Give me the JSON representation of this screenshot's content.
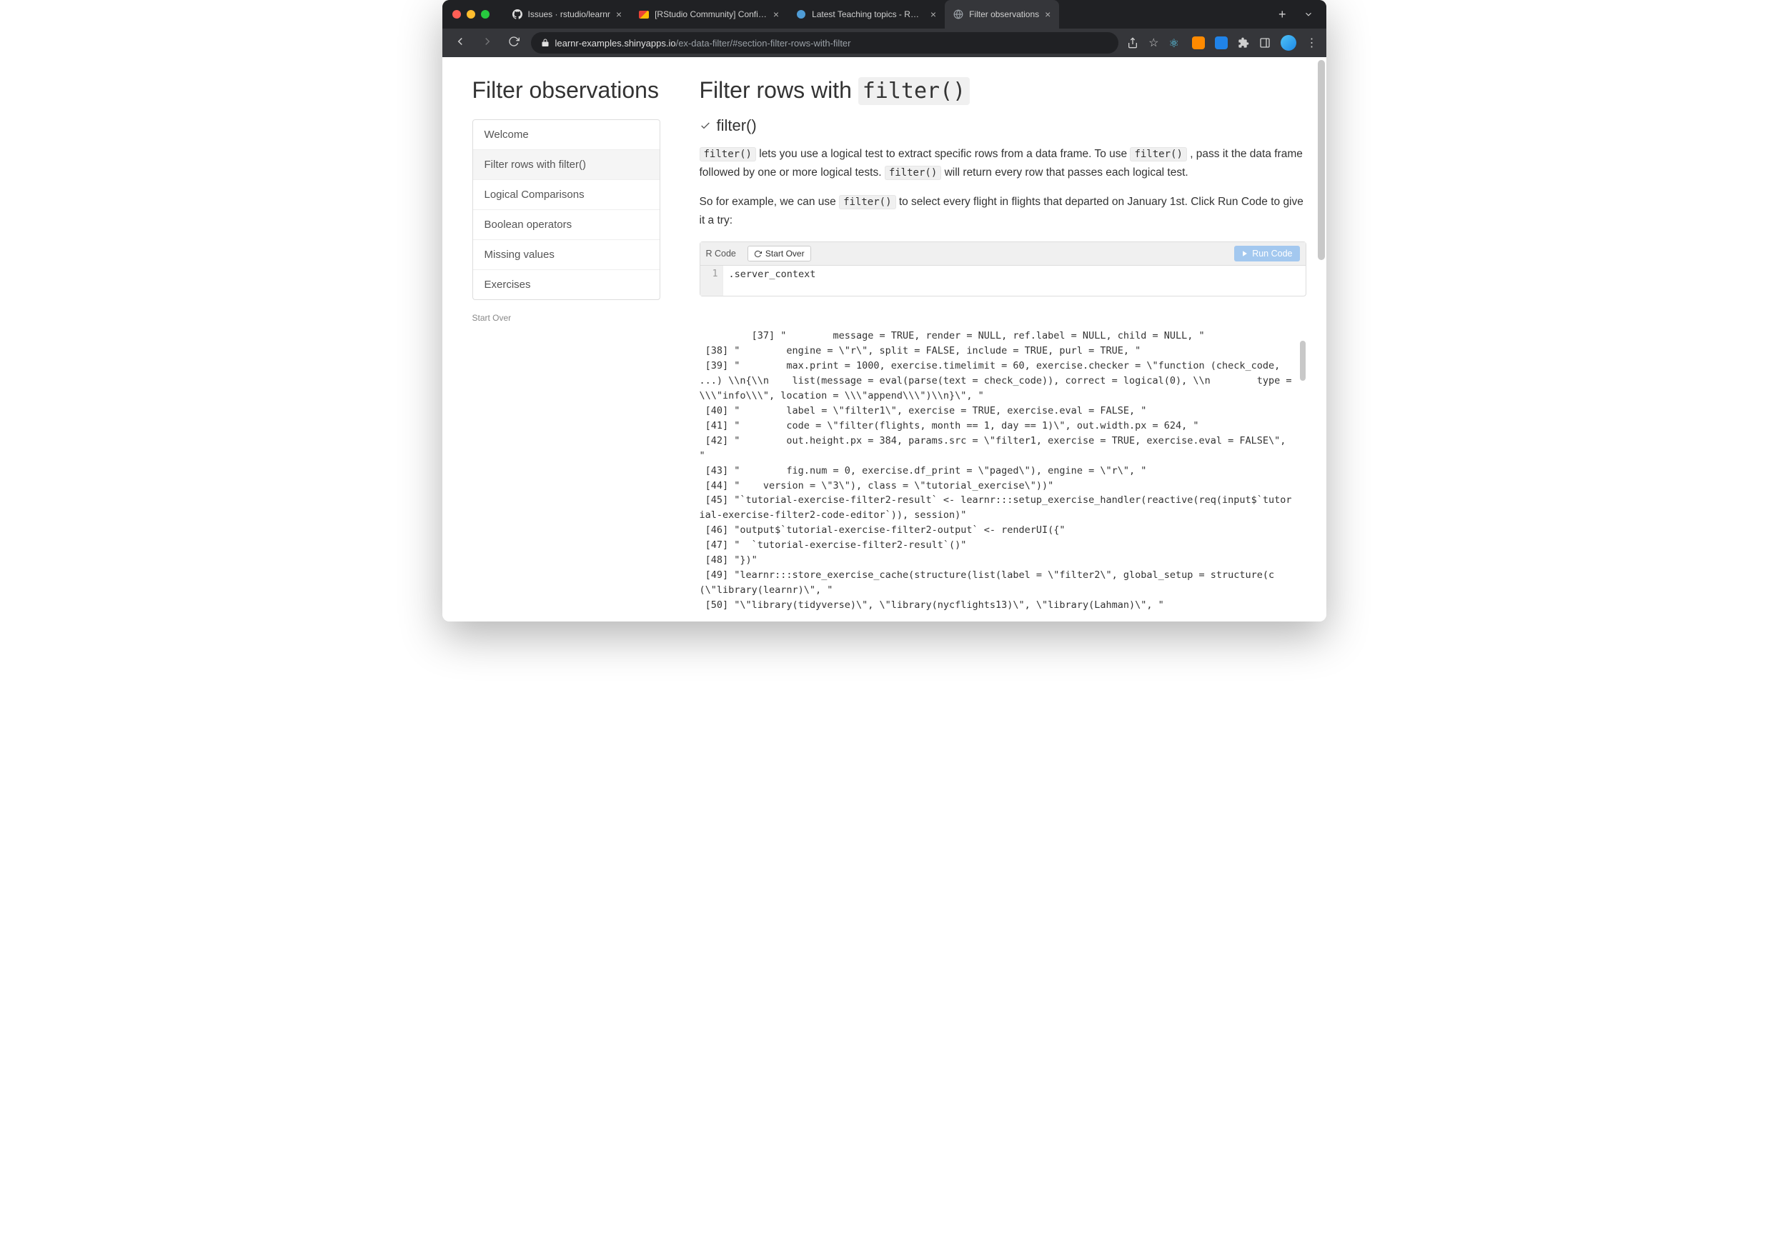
{
  "browser": {
    "tabs": [
      {
        "title": "Issues · rstudio/learnr",
        "active": false,
        "favicon": "github"
      },
      {
        "title": "[RStudio Community] Confirm",
        "active": false,
        "favicon": "gmail"
      },
      {
        "title": "Latest Teaching topics - RSt…",
        "active": false,
        "favicon": "rstudio"
      },
      {
        "title": "Filter observations",
        "active": true,
        "favicon": "globe"
      }
    ],
    "url_host": "learnr-examples.shinyapps.io",
    "url_path": "/ex-data-filter/#section-filter-rows-with-filter"
  },
  "sidebar": {
    "title": "Filter observations",
    "items": [
      {
        "label": "Welcome",
        "active": false
      },
      {
        "label": "Filter rows with filter()",
        "active": true
      },
      {
        "label": "Logical Comparisons",
        "active": false
      },
      {
        "label": "Boolean operators",
        "active": false
      },
      {
        "label": "Missing values",
        "active": false
      },
      {
        "label": "Exercises",
        "active": false
      }
    ],
    "start_over": "Start Over"
  },
  "main": {
    "heading_prefix": "Filter rows with ",
    "heading_code": "filter()",
    "subheading": "filter()",
    "para1_a": "filter()",
    "para1_b": " lets you use a logical test to extract specific rows from a data frame. To use ",
    "para1_c": "filter()",
    "para1_d": " , pass it the data frame followed by one or more logical tests. ",
    "para1_e": "filter()",
    "para1_f": " will return every row that passes each logical test.",
    "para2_a": "So for example, we can use ",
    "para2_b": "filter()",
    "para2_c": " to select every flight in flights that departed on January 1st. Click Run Code to give it a try:"
  },
  "exercise": {
    "label": "R Code",
    "start_over_label": "Start Over",
    "run_label": "Run Code",
    "gutter_line": "1",
    "code": ".server_context"
  },
  "output_lines": [
    " [37] \"        message = TRUE, render = NULL, ref.label = NULL, child = NULL, \"",
    " [38] \"        engine = \\\"r\\\", split = FALSE, include = TRUE, purl = TRUE, \"",
    " [39] \"        max.print = 1000, exercise.timelimit = 60, exercise.checker = \\\"function (check_code, ...) \\\\n{\\\\n    list(message = eval(parse(text = check_code)), correct = logical(0), \\\\n        type = \\\\\\\"info\\\\\\\", location = \\\\\\\"append\\\\\\\")\\\\n}\\\", \"",
    " [40] \"        label = \\\"filter1\\\", exercise = TRUE, exercise.eval = FALSE, \"",
    " [41] \"        code = \\\"filter(flights, month == 1, day == 1)\\\", out.width.px = 624, \"",
    " [42] \"        out.height.px = 384, params.src = \\\"filter1, exercise = TRUE, exercise.eval = FALSE\\\", \"",
    " [43] \"        fig.num = 0, exercise.df_print = \\\"paged\\\"), engine = \\\"r\\\", \"",
    " [44] \"    version = \\\"3\\\"), class = \\\"tutorial_exercise\\\"))\"",
    " [45] \"`tutorial-exercise-filter2-result` <- learnr:::setup_exercise_handler(reactive(req(input$`tutorial-exercise-filter2-code-editor`)), session)\"",
    " [46] \"output$`tutorial-exercise-filter2-output` <- renderUI({\"",
    " [47] \"  `tutorial-exercise-filter2-result`()\"",
    " [48] \"})\"",
    " [49] \"learnr:::store_exercise_cache(structure(list(label = \\\"filter2\\\", global_setup = structure(c(\\\"library(learnr)\\\", \"",
    " [50] \"\\\"library(tidyverse)\\\", \\\"library(nycflights13)\\\", \\\"library(Lahman)\\\", \""
  ]
}
